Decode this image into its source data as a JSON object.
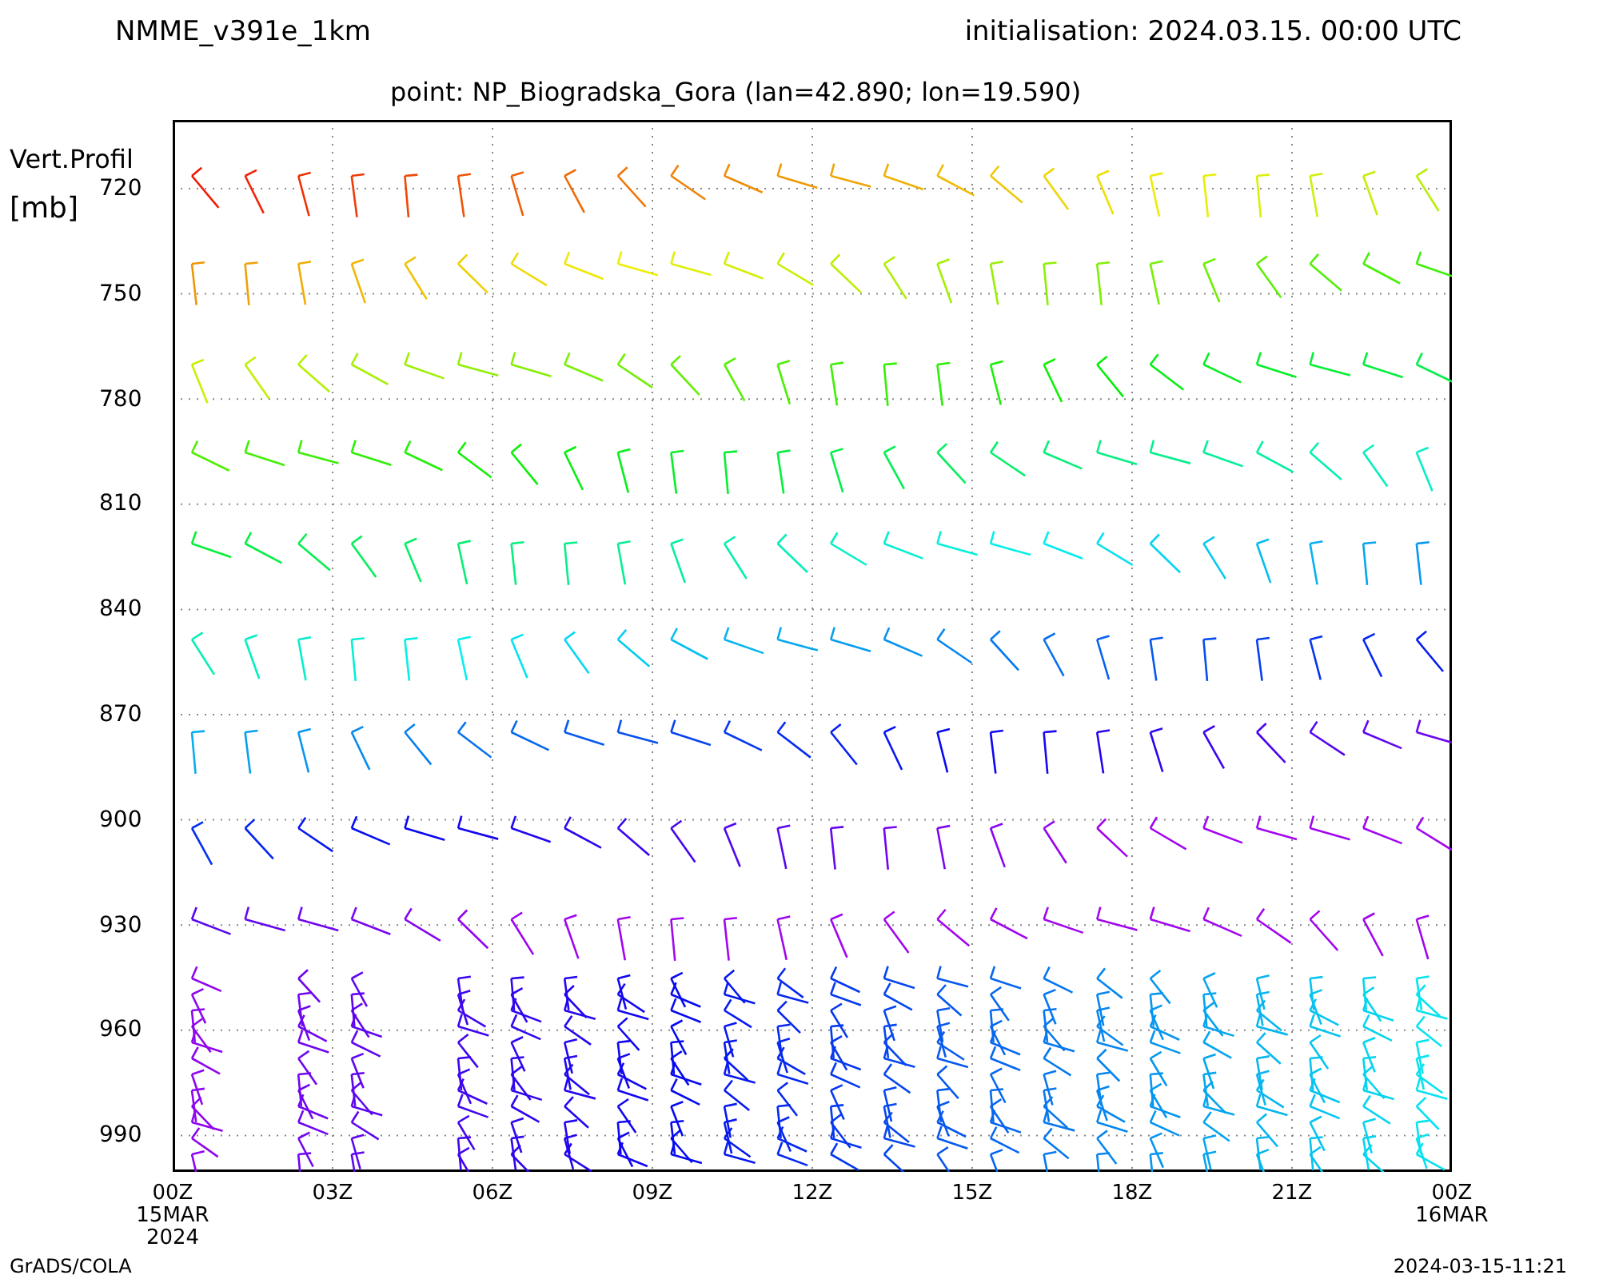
{
  "header": {
    "model": "NMME_v391e_1km",
    "init": "initialisation: 2024.03.15. 00:00 UTC",
    "point": "point: NP_Biogradska_Gora (lan=42.890; lon=19.590)"
  },
  "y_axis": {
    "title": "Vert.Profil",
    "unit": "[mb]",
    "ticks": [
      "720",
      "750",
      "780",
      "810",
      "840",
      "870",
      "900",
      "930",
      "960",
      "990"
    ]
  },
  "x_axis": {
    "ticks": [
      {
        "label": "00Z",
        "sub": [
          "15MAR",
          "2024"
        ]
      },
      {
        "label": "03Z"
      },
      {
        "label": "06Z"
      },
      {
        "label": "09Z"
      },
      {
        "label": "12Z"
      },
      {
        "label": "15Z"
      },
      {
        "label": "18Z"
      },
      {
        "label": "21Z"
      },
      {
        "label": "00Z",
        "sub": [
          "16MAR"
        ]
      }
    ]
  },
  "footer": {
    "left": "GrADS/COLA",
    "right": "2024-03-15-11:21"
  }
}
